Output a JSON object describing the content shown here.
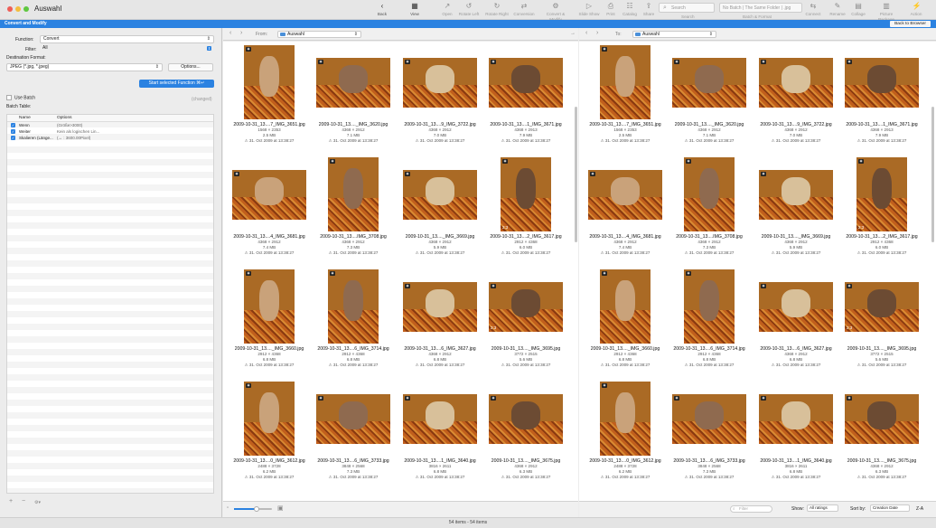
{
  "window": {
    "title": "Auswahl"
  },
  "toolbar": {
    "items": [
      {
        "label": "Back",
        "icon": "chevron-left-icon"
      },
      {
        "label": "View",
        "icon": "view-mode-icon"
      },
      {
        "label": "Open",
        "icon": "open-icon"
      },
      {
        "label": "Rotate Left",
        "icon": "rotate-left-icon"
      },
      {
        "label": "Rotate Right",
        "icon": "rotate-right-icon"
      },
      {
        "label": "Conversion",
        "icon": "conversion-icon"
      },
      {
        "label": "Convert & Modify",
        "icon": "convert-modify-icon"
      },
      {
        "label": "Slide Show",
        "icon": "slideshow-icon"
      },
      {
        "label": "Print",
        "icon": "print-icon"
      },
      {
        "label": "Catalog",
        "icon": "catalog-icon"
      },
      {
        "label": "Share",
        "icon": "share-icon"
      },
      {
        "label": "Connect",
        "icon": "connect-icon"
      },
      {
        "label": "Rename",
        "icon": "rename-icon"
      },
      {
        "label": "Collage",
        "icon": "collage-icon"
      },
      {
        "label": "Picture Package",
        "icon": "picture-package-icon"
      },
      {
        "label": "Action",
        "icon": "action-icon"
      }
    ],
    "search_placeholder": "Search",
    "search_label": "Search",
    "batch_value": "No Batch | The Same Folder | .jpg",
    "batch_label": "Batch & Format"
  },
  "bluebar": {
    "title": "Convert and Modify",
    "back_button": "Back to Browser"
  },
  "left": {
    "function_label": "Function:",
    "function_value": "Convert",
    "filter_label": "Filter:",
    "filter_value": "All",
    "dest_label": "Destination Format:",
    "dest_value": "JPEG (*.jpg, *.jpeg)",
    "options_button": "Options...",
    "start_button": "Start selected Function  ⌘↵",
    "use_batch": "Use Batch",
    "changed": "(changed)",
    "batch_table_label": "Batch Table:",
    "col_name": "Name",
    "col_options": "Options",
    "rows": [
      {
        "name": "Wenn",
        "options": "(Größe>3000)"
      },
      {
        "name": "Weiter",
        "options": "Kein als logischen Lin..."
      },
      {
        "name": "Skalieren (Länge...",
        "options": "(↔ : 3600.00Pixel)"
      }
    ],
    "add_label": "+",
    "remove_label": "−",
    "gear_label": "⚙▾"
  },
  "left_pane": {
    "from_label": "From:",
    "path": "Auswahl"
  },
  "right_pane": {
    "to_label": "To:",
    "path": "Auswahl"
  },
  "images": [
    {
      "name": "2009-10-31_13....7_IMG_3651.jpg",
      "dim": "1568 × 2353",
      "size": "2.5 MB",
      "date": "31. Oct 2009 at 13:38:27"
    },
    {
      "name": "2009-10-31_13...._IMG_3620.jpg",
      "dim": "4368 × 2912",
      "size": "7.1 MB",
      "date": "31. Oct 2009 at 13:38:27"
    },
    {
      "name": "2009-10-31_13....9_IMG_3722.jpg",
      "dim": "4368 × 2912",
      "size": "7.0 MB",
      "date": "31. Oct 2009 at 13:38:27"
    },
    {
      "name": "2009-10-31_13....1_IMG_3671.jpg",
      "dim": "4368 × 2913",
      "size": "7.9 MB",
      "date": "31. Oct 2009 at 13:38:27"
    },
    {
      "name": "2009-10-31_13....4_IMG_3681.jpg",
      "dim": "4368 × 2912",
      "size": "7.4 MB",
      "date": "31. Oct 2009 at 13:38:27"
    },
    {
      "name": "2009-10-31_13....IMG_3708.jpg",
      "dim": "4368 × 2912",
      "size": "7.3 MB",
      "date": "31. Oct 2009 at 13:38:27"
    },
    {
      "name": "2009-10-31_13...._IMG_3669.jpg",
      "dim": "4368 × 2912",
      "size": "5.9 MB",
      "date": "31. Oct 2009 at 13:38:27"
    },
    {
      "name": "2009-10-31_13....2_IMG_3617.jpg",
      "dim": "2912 × 4368",
      "size": "6.0 MB",
      "date": "31. Oct 2009 at 13:38:27"
    },
    {
      "name": "2009-10-31_13...._IMG_3660.jpg",
      "dim": "2912 × 4368",
      "size": "6.8 MB",
      "date": "31. Oct 2009 at 13:38:27"
    },
    {
      "name": "2009-10-31_13....6_IMG_3714.jpg",
      "dim": "2912 × 4368",
      "size": "6.8 MB",
      "date": "31. Oct 2009 at 13:38:27"
    },
    {
      "name": "2009-10-31_13....6_IMG_3627.jpg",
      "dim": "4368 × 2912",
      "size": "6.8 MB",
      "date": "31. Oct 2009 at 13:38:27"
    },
    {
      "name": "2009-10-31_13...._IMG_3695.jpg",
      "dim": "3772 × 2515",
      "size": "5.6 MB",
      "date": "31. Oct 2009 at 13:38:27"
    },
    {
      "name": "2009-10-31_13....0_IMG_3612.jpg",
      "dim": "2488 × 3728",
      "size": "6.2 MB",
      "date": "31. Oct 2009 at 13:38:27"
    },
    {
      "name": "2009-10-31_13....6_IMG_3733.jpg",
      "dim": "3848 × 2568",
      "size": "7.3 MB",
      "date": "31. Oct 2009 at 13:38:27"
    },
    {
      "name": "2009-10-31_13....1_IMG_3640.jpg",
      "dim": "3816 × 2611",
      "size": "6.8 MB",
      "date": "31. Oct 2009 at 13:38:27"
    },
    {
      "name": "2009-10-31_13...._IMG_3675.jpg",
      "dim": "4368 × 2912",
      "size": "6.3 MB",
      "date": "31. Oct 2009 at 13:38:27"
    }
  ],
  "footer": {
    "filter_placeholder": "Filter",
    "show_label": "Show:",
    "show_value": "All ratings",
    "sortby_label": "Sort by:",
    "sortby_value": "Creation Date",
    "sort_dir": "Z-A"
  },
  "status": "54 items - 54 items"
}
